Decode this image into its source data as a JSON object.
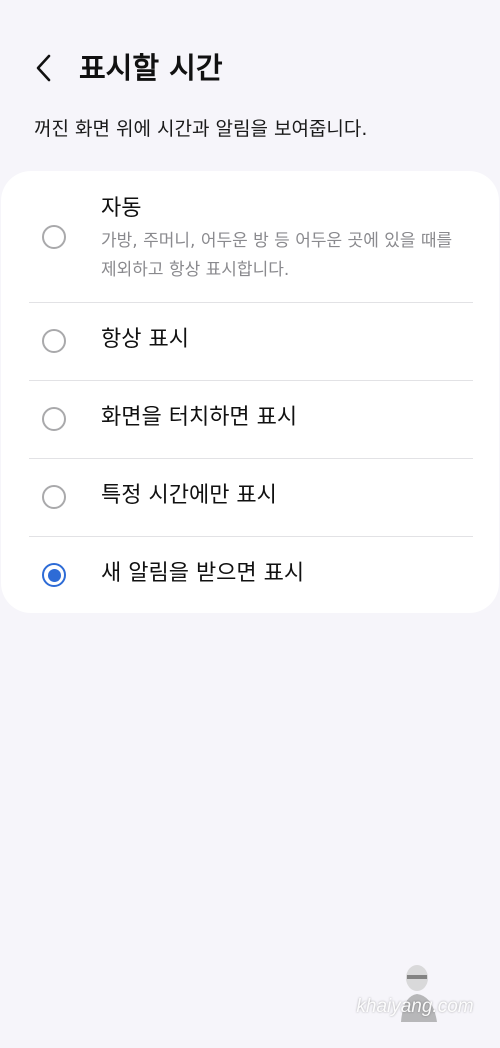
{
  "header": {
    "title": "표시할 시간"
  },
  "description": "꺼진 화면 위에 시간과 알림을 보여줍니다.",
  "options": [
    {
      "label": "자동",
      "sublabel": "가방, 주머니, 어두운 방 등 어두운 곳에 있을 때를 제외하고 항상 표시합니다.",
      "checked": false
    },
    {
      "label": "항상 표시",
      "checked": false
    },
    {
      "label": "화면을 터치하면 표시",
      "checked": false
    },
    {
      "label": "특정 시간에만 표시",
      "checked": false
    },
    {
      "label": "새 알림을 받으면 표시",
      "checked": true
    }
  ],
  "colors": {
    "accent": "#2d6bd6",
    "background": "#f6f5fa",
    "card": "#ffffff"
  },
  "watermark": "khaiyang.com"
}
